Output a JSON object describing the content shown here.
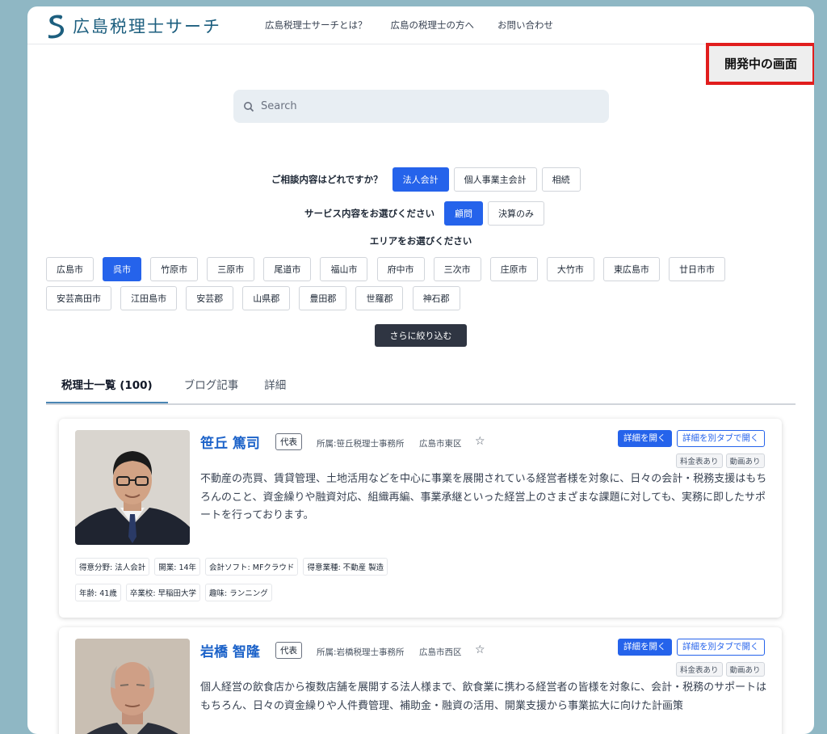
{
  "header": {
    "logo_text": "広島税理士サーチ",
    "nav": [
      "広島税理士サーチとは？",
      "広島の税理士の方へ",
      "お問い合わせ"
    ]
  },
  "dev_badge": "開発中の画面",
  "search": {
    "placeholder": "Search"
  },
  "consult": {
    "label": "ご相談内容はどれですか？",
    "options": [
      "法人会計",
      "個人事業主会計",
      "相続"
    ],
    "selected": "法人会計"
  },
  "service": {
    "label": "サービス内容をお選びください",
    "options": [
      "顧問",
      "決算のみ"
    ],
    "selected": "顧問"
  },
  "area": {
    "label": "エリアをお選びください",
    "options": [
      "広島市",
      "呉市",
      "竹原市",
      "三原市",
      "尾道市",
      "福山市",
      "府中市",
      "三次市",
      "庄原市",
      "大竹市",
      "東広島市",
      "廿日市市",
      "安芸高田市",
      "江田島市",
      "安芸郡",
      "山県郡",
      "豊田郡",
      "世羅郡",
      "神石郡"
    ],
    "selected": "呉市"
  },
  "narrow_button": "さらに絞り込む",
  "tabs": [
    "税理士一覧 (100)",
    "ブログ記事",
    "詳細"
  ],
  "cards": [
    {
      "name": "笹丘 篤司",
      "role": "代表",
      "office": "所属:笹丘税理士事務所",
      "city": "広島市東区",
      "open_label": "詳細を開く",
      "open_tab_label": "詳細を別タブで開く",
      "info_tags": [
        "料金表あり",
        "動画あり"
      ],
      "description": "不動産の売買、賃貸管理、土地活用などを中心に事業を展開されている経営者様を対象に、日々の会計・税務支援はもちろんのこと、資金繰りや融資対応、組織再編、事業承継といった経営上のさまざまな課題に対しても、実務に即したサポートを行っております。",
      "attributes": [
        "得意分野: 法人会計",
        "開業: 14年",
        "会計ソフト: MFクラウド",
        "得意業種: 不動産 製造",
        "年齢: 41歳",
        "卒業校: 早稲田大学",
        "趣味: ランニング"
      ]
    },
    {
      "name": "岩橋 智隆",
      "role": "代表",
      "office": "所属:岩橋税理士事務所",
      "city": "広島市西区",
      "open_label": "詳細を開く",
      "open_tab_label": "詳細を別タブで開く",
      "info_tags": [
        "料金表あり",
        "動画あり"
      ],
      "description": "個人経営の飲食店から複数店舗を展開する法人様まで、飲食業に携わる経営者の皆様を対象に、会計・税務のサポートはもちろん、日々の資金繰りや人件費管理、補助金・融資の活用、開業支援から事業拡大に向けた計画策",
      "attributes": []
    }
  ]
}
